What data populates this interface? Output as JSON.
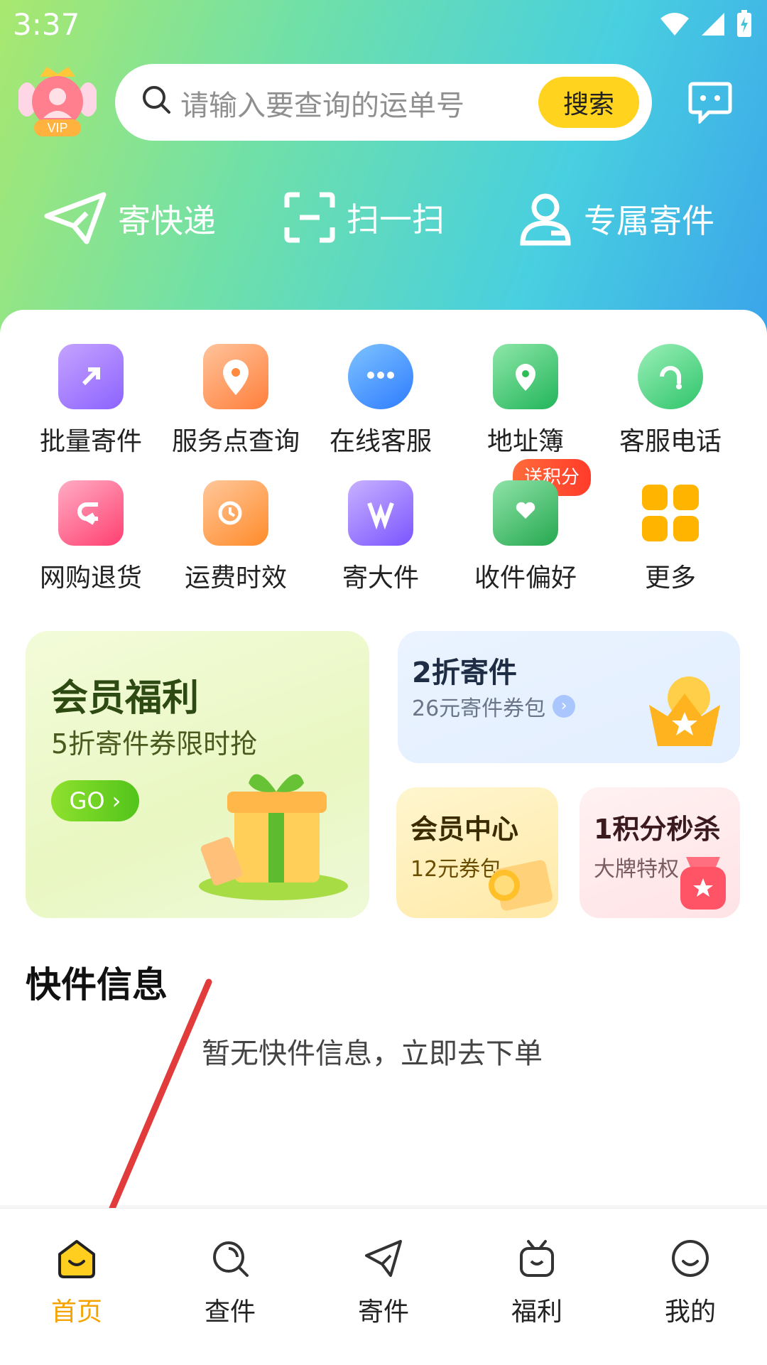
{
  "status": {
    "time": "3:37"
  },
  "search": {
    "placeholder": "请输入要查询的运单号",
    "button_label": "搜索"
  },
  "vip": {
    "label": "VIP"
  },
  "quick_actions": [
    {
      "label": "寄快递",
      "icon": "paper-plane-icon"
    },
    {
      "label": "扫一扫",
      "icon": "scan-icon"
    },
    {
      "label": "专属寄件",
      "icon": "user-icon"
    }
  ],
  "services": [
    {
      "label": "批量寄件",
      "icon": "batch-send-icon",
      "color": "#9b6bff"
    },
    {
      "label": "服务点查询",
      "icon": "map-pin-icon",
      "color": "#ff8a3d"
    },
    {
      "label": "在线客服",
      "icon": "chat-bubble-icon",
      "color": "#3b8cff"
    },
    {
      "label": "地址簿",
      "icon": "address-book-icon",
      "color": "#31c06b"
    },
    {
      "label": "客服电话",
      "icon": "phone-icon",
      "color": "#3fcf7a"
    },
    {
      "label": "网购退货",
      "icon": "return-icon",
      "color": "#ff4f7d"
    },
    {
      "label": "运费时效",
      "icon": "truck-icon",
      "color": "#ff9a3d"
    },
    {
      "label": "寄大件",
      "icon": "big-parcel-icon",
      "color": "#8e6bff"
    },
    {
      "label": "收件偏好",
      "icon": "inbox-heart-icon",
      "color": "#2fbd5a"
    },
    {
      "label": "更多",
      "icon": "more-grid-icon",
      "color": "#ffb400"
    }
  ],
  "badge_label": "送积分",
  "promos": {
    "member": {
      "title": "会员福利",
      "subtitle": "5折寄件券限时抢",
      "cta": "GO ›"
    },
    "discount": {
      "title": "2折寄件",
      "subtitle": "26元寄件券包"
    },
    "center": {
      "title": "会员中心",
      "subtitle": "12元券包"
    },
    "seckill": {
      "title": "1积分秒杀",
      "subtitle": "大牌特权"
    }
  },
  "section": {
    "title": "快件信息",
    "empty": "暂无快件信息，立即去下单"
  },
  "nav": [
    {
      "label": "首页",
      "icon": "home-icon",
      "active": true
    },
    {
      "label": "查件",
      "icon": "search-parcel-icon",
      "active": false
    },
    {
      "label": "寄件",
      "icon": "send-icon",
      "active": false
    },
    {
      "label": "福利",
      "icon": "gift-tv-icon",
      "active": false
    },
    {
      "label": "我的",
      "icon": "smile-icon",
      "active": false
    }
  ],
  "colors": {
    "accent": "#f5a300",
    "search_button": "#ffd31e",
    "arrow": "#e23b3b"
  }
}
